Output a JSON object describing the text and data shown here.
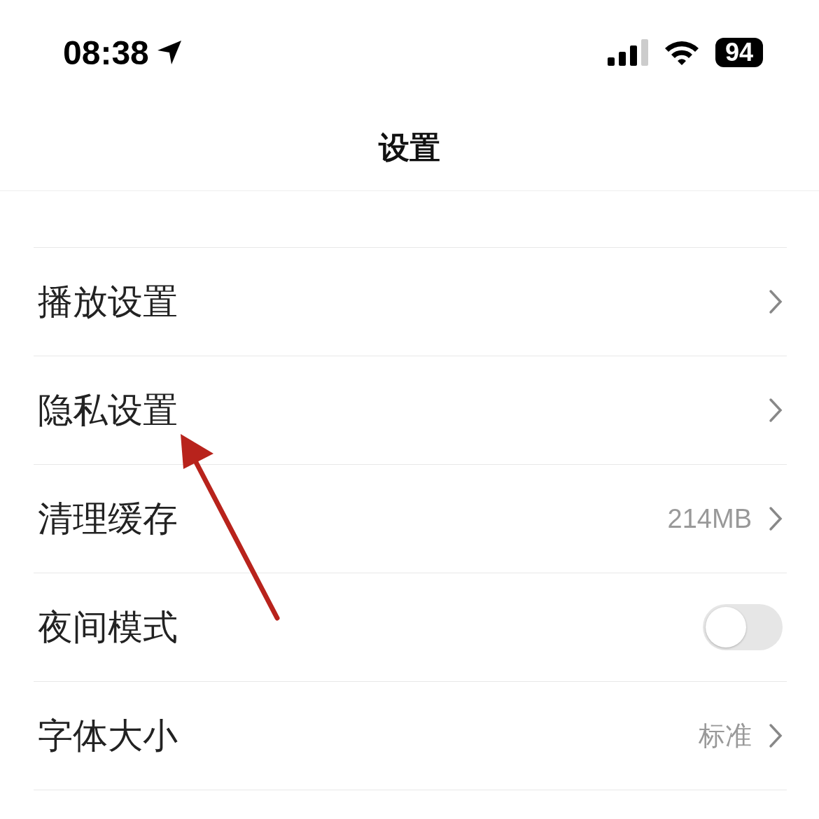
{
  "status_bar": {
    "time": "08:38",
    "battery": "94"
  },
  "header": {
    "title": "设置"
  },
  "rows": [
    {
      "kind": "link",
      "label": "播放设置"
    },
    {
      "kind": "link",
      "label": "隐私设置"
    },
    {
      "kind": "link",
      "label": "清理缓存",
      "value": "214MB"
    },
    {
      "kind": "toggle",
      "label": "夜间模式",
      "on": false
    },
    {
      "kind": "link",
      "label": "字体大小",
      "value": "标准"
    }
  ]
}
